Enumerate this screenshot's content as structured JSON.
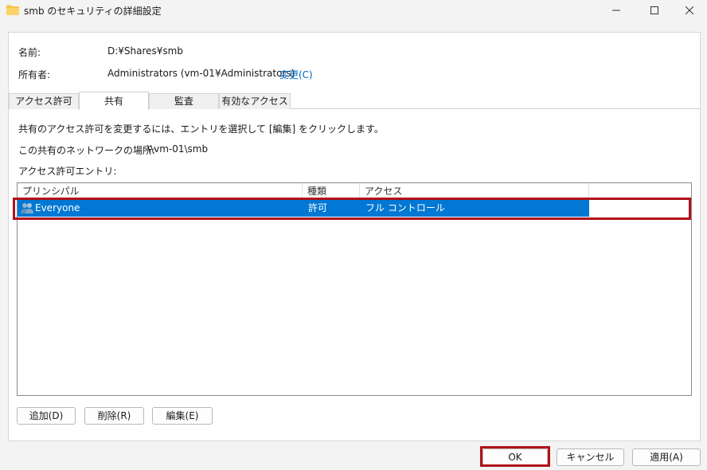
{
  "window": {
    "title": "smb のセキュリティの詳細設定",
    "controls": {
      "minimize": "minimize",
      "maximize": "maximize",
      "close": "close"
    }
  },
  "properties": {
    "name_label": "名前:",
    "name_value": "D:¥Shares¥smb",
    "owner_label": "所有者:",
    "owner_value": "Administrators (vm-01¥Administrators)",
    "change_link": "変更(C)"
  },
  "tabs": [
    {
      "label": "アクセス許可",
      "active": false
    },
    {
      "label": "共有",
      "active": true
    },
    {
      "label": "監査",
      "active": false
    },
    {
      "label": "有効なアクセス",
      "active": false
    }
  ],
  "share": {
    "instructions": "共有のアクセス許可を変更するには、エントリを選択して [編集] をクリックします。",
    "network_location_label": "この共有のネットワークの場所:",
    "network_location_value": "\\\\vm-01\\smb",
    "entries_label": "アクセス許可エントリ:"
  },
  "table": {
    "columns": [
      "プリンシパル",
      "種類",
      "アクセス"
    ],
    "rows": [
      {
        "principal": "Everyone",
        "type": "許可",
        "access": "フル コントロール",
        "selected": true,
        "icon": "users-icon"
      }
    ]
  },
  "actions": {
    "add": "追加(D)",
    "remove": "削除(R)",
    "edit": "編集(E)"
  },
  "footer": {
    "ok": "OK",
    "cancel": "キャンセル",
    "apply": "適用(A)"
  },
  "colors": {
    "selection": "#0078d4",
    "link": "#0067c0",
    "highlight_box": "#b0121b",
    "folder": "#f7c74d"
  }
}
